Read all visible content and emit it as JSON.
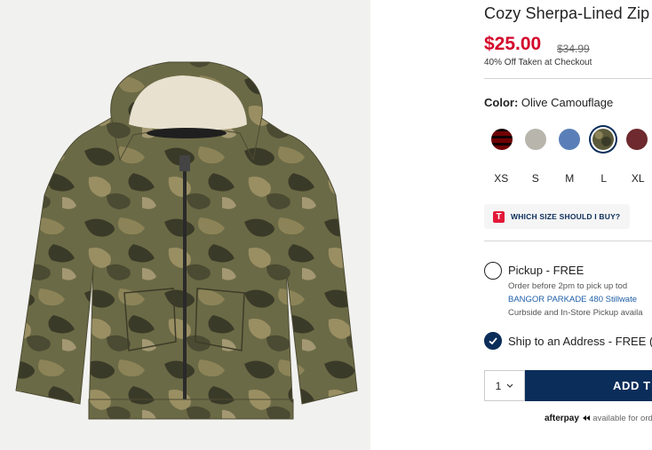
{
  "product": {
    "title": "Cozy Sherpa-Lined Zip",
    "price": "$25.00",
    "original_price": "$34.99",
    "promo": "40% Off Taken at Checkout"
  },
  "color": {
    "label": "Color:",
    "selected": "Olive Camouflage",
    "swatches": [
      {
        "name": "red-plaid",
        "hex": "#a8161f"
      },
      {
        "name": "heather-gray",
        "hex": "#b7b5ac"
      },
      {
        "name": "blue",
        "hex": "#5a7fb8"
      },
      {
        "name": "olive-camouflage",
        "hex": "#5b5a3a",
        "selected": true
      },
      {
        "name": "burgundy",
        "hex": "#6e2a2e"
      }
    ]
  },
  "sizes": [
    "XS",
    "S",
    "M",
    "L",
    "XL"
  ],
  "size_guide": {
    "icon": "T",
    "label": "WHICH SIZE SHOULD I BUY?"
  },
  "fulfillment": {
    "pickup": {
      "title": "Pickup - FREE",
      "line1": "Order before 2pm to pick up tod",
      "store": "BANGOR PARKADE 480 Stillwate",
      "line3": "Curbside and In-Store Pickup availa"
    },
    "ship": {
      "title": "Ship to an Address - FREE ("
    }
  },
  "cart": {
    "quantity": "1",
    "add_label": "ADD T"
  },
  "afterpay": {
    "logo": "afterpay",
    "text": "available for ord"
  },
  "colors": {
    "accent": "#0b2d5a",
    "sale": "#d3062b"
  }
}
